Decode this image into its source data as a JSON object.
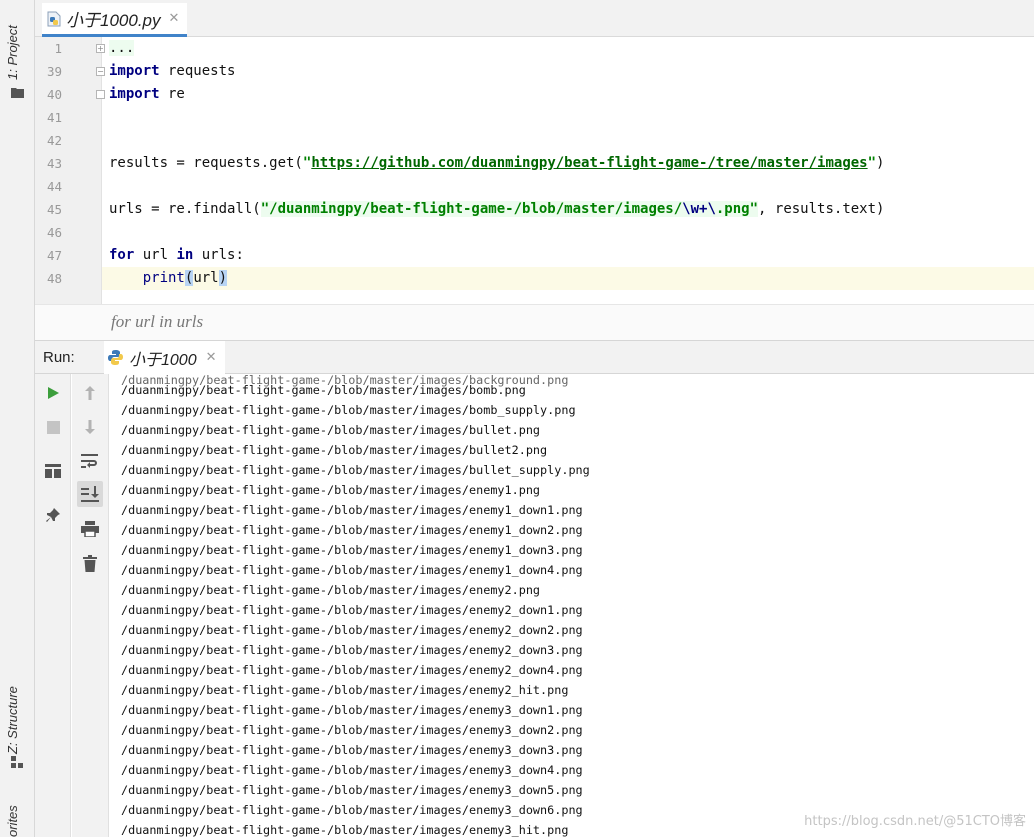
{
  "leftbar": {
    "project_label": "1: Project",
    "structure_label": "Z: Structure",
    "favorites_label": "orites"
  },
  "editor": {
    "tab_title": "小于1000.py",
    "lines": [
      {
        "no": "1"
      },
      {
        "no": "39"
      },
      {
        "no": "40"
      },
      {
        "no": "41"
      },
      {
        "no": "42"
      },
      {
        "no": "43"
      },
      {
        "no": "44"
      },
      {
        "no": "45"
      },
      {
        "no": "46"
      },
      {
        "no": "47"
      },
      {
        "no": "48"
      }
    ],
    "code": {
      "l1_ellipsis": "...",
      "kw_import": "import",
      "mod_requests": " requests",
      "mod_re": " re",
      "l43_prefix": "results = requests.get(",
      "l43_url": "https://github.com/duanmingpy/beat-flight-game-/tree/master/images",
      "l43_suffix": ")",
      "l45_prefix": "urls = re.findall(",
      "l45_str_a": "\"/duanmingpy/beat-flight-game-/blob/master/images/",
      "l45_esc": "\\w+\\",
      "l45_str_b": ".png\"",
      "l45_suffix": ", results.text)",
      "kw_for": "for",
      "l47_mid": " url ",
      "kw_in": "in",
      "l47_end": " urls:",
      "l48_indent": "    ",
      "l48_print": "print",
      "l48_open": "(",
      "l48_arg": "url",
      "l48_close": ")"
    },
    "breadcrumb": "for url in urls"
  },
  "run": {
    "label": "Run:",
    "tab_title": "小于1000"
  },
  "console": {
    "lines": [
      "/duanmingpy/beat-flight-game-/blob/master/images/bomb.png",
      "/duanmingpy/beat-flight-game-/blob/master/images/bomb_supply.png",
      "/duanmingpy/beat-flight-game-/blob/master/images/bullet.png",
      "/duanmingpy/beat-flight-game-/blob/master/images/bullet2.png",
      "/duanmingpy/beat-flight-game-/blob/master/images/bullet_supply.png",
      "/duanmingpy/beat-flight-game-/blob/master/images/enemy1.png",
      "/duanmingpy/beat-flight-game-/blob/master/images/enemy1_down1.png",
      "/duanmingpy/beat-flight-game-/blob/master/images/enemy1_down2.png",
      "/duanmingpy/beat-flight-game-/blob/master/images/enemy1_down3.png",
      "/duanmingpy/beat-flight-game-/blob/master/images/enemy1_down4.png",
      "/duanmingpy/beat-flight-game-/blob/master/images/enemy2.png",
      "/duanmingpy/beat-flight-game-/blob/master/images/enemy2_down1.png",
      "/duanmingpy/beat-flight-game-/blob/master/images/enemy2_down2.png",
      "/duanmingpy/beat-flight-game-/blob/master/images/enemy2_down3.png",
      "/duanmingpy/beat-flight-game-/blob/master/images/enemy2_down4.png",
      "/duanmingpy/beat-flight-game-/blob/master/images/enemy2_hit.png",
      "/duanmingpy/beat-flight-game-/blob/master/images/enemy3_down1.png",
      "/duanmingpy/beat-flight-game-/blob/master/images/enemy3_down2.png",
      "/duanmingpy/beat-flight-game-/blob/master/images/enemy3_down3.png",
      "/duanmingpy/beat-flight-game-/blob/master/images/enemy3_down4.png",
      "/duanmingpy/beat-flight-game-/blob/master/images/enemy3_down5.png",
      "/duanmingpy/beat-flight-game-/blob/master/images/enemy3_down6.png",
      "/duanmingpy/beat-flight-game-/blob/master/images/enemy3_hit.png"
    ]
  },
  "watermark": "https://blog.csdn.net/@51CTO博客",
  "colors": {
    "keyword": "#000080",
    "string": "#008000",
    "current_line": "#fcfae6",
    "run_icon": "#3c9e3c",
    "tab_underline": "#4083c9"
  },
  "icons": {
    "file_tab": "python-file-icon",
    "run_tab": "python-icon",
    "toolbar": [
      "rerun-icon",
      "stop-icon",
      "layout-icon",
      "pin-icon",
      "up-arrow-icon",
      "down-arrow-icon",
      "soft-wrap-icon",
      "scroll-to-end-icon",
      "print-icon",
      "trash-icon"
    ]
  }
}
